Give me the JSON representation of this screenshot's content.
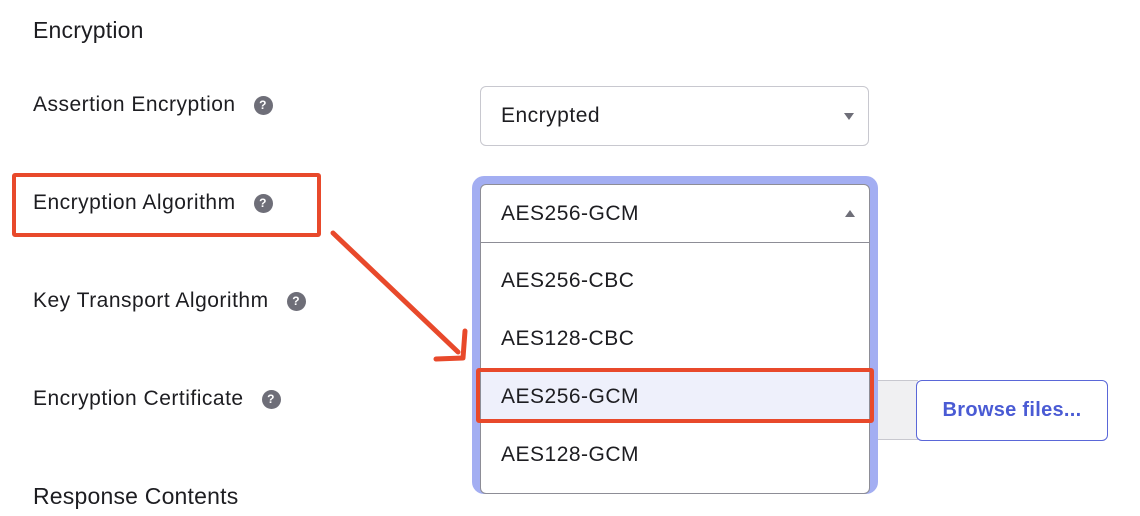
{
  "encryption_section": {
    "title": "Encryption"
  },
  "fields": {
    "assertion_encryption": {
      "label": "Assertion Encryption",
      "value": "Encrypted"
    },
    "encryption_algorithm": {
      "label": "Encryption Algorithm",
      "value": "AES256-GCM"
    },
    "key_transport_algorithm": {
      "label": "Key Transport Algorithm"
    },
    "encryption_certificate": {
      "label": "Encryption Certificate",
      "browse_label": "Browse files..."
    }
  },
  "help_icon": {
    "glyph": "?"
  },
  "dropdown": {
    "options": [
      "AES256-CBC",
      "AES128-CBC",
      "AES256-GCM",
      "AES128-GCM"
    ],
    "selected": "AES256-GCM"
  },
  "response_section": {
    "title": "Response Contents"
  },
  "colors": {
    "focus_ring": "#a3aef2",
    "annotation": "#e8492b",
    "link_blue": "#4a5bd4",
    "help_icon_bg": "#6e6e78"
  }
}
